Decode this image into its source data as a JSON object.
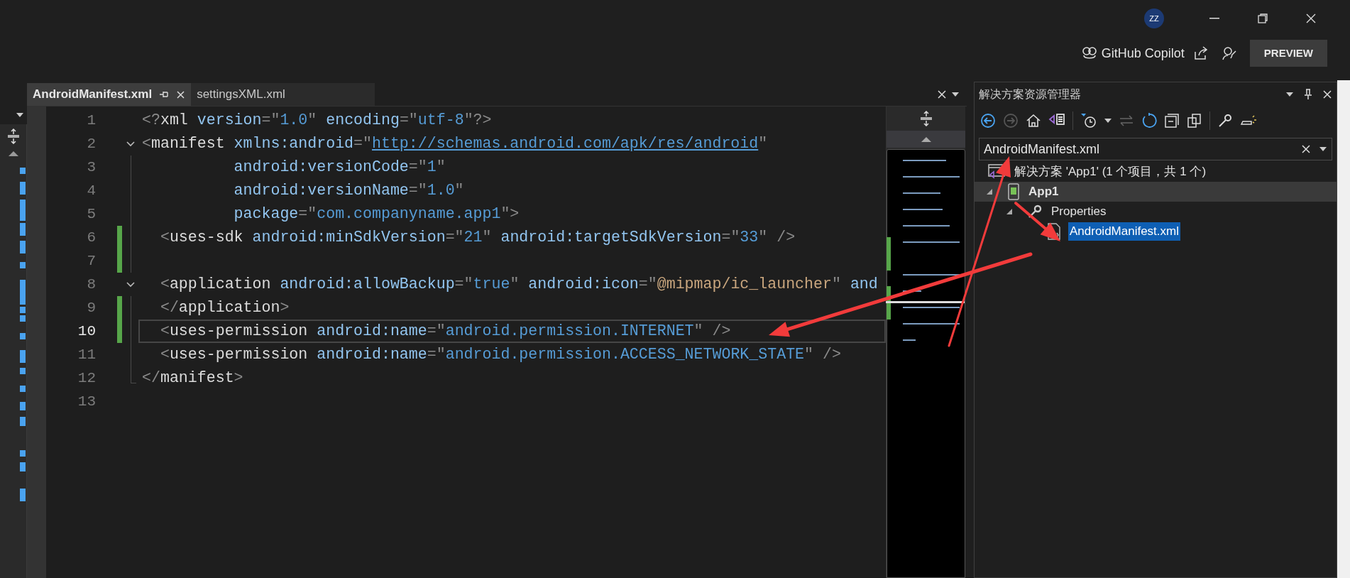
{
  "title_bar": {
    "avatar": "ZZ",
    "copilot": "GitHub Copilot",
    "preview_button": "PREVIEW"
  },
  "editor": {
    "tabs": [
      {
        "label": "AndroidManifest.xml",
        "selected": true
      },
      {
        "label": "settingsXML.xml",
        "selected": false
      }
    ],
    "lines": [
      {
        "number": "1",
        "changed": false,
        "current": false,
        "kind": "plain",
        "tokens": [
          {
            "kind": "punct",
            "text": "<?"
          },
          {
            "kind": "tag",
            "text": "xml"
          },
          {
            "kind": "attr",
            "text": " version"
          },
          {
            "kind": "punct",
            "text": "=\""
          },
          {
            "kind": "value",
            "text": "1.0"
          },
          {
            "kind": "punct",
            "text": "\""
          },
          {
            "kind": "attr",
            "text": " encoding"
          },
          {
            "kind": "punct",
            "text": "=\""
          },
          {
            "kind": "value",
            "text": "utf-8"
          },
          {
            "kind": "punct",
            "text": "\"?>"
          }
        ]
      },
      {
        "number": "2",
        "changed": false,
        "current": false,
        "kind": "start",
        "tokens": [
          {
            "kind": "punct",
            "text": "<"
          },
          {
            "kind": "tag",
            "text": "manifest"
          },
          {
            "kind": "attr",
            "text": " xmlns:android"
          },
          {
            "kind": "punct",
            "text": "=\""
          },
          {
            "kind": "link",
            "text": "http://schemas.android.com/apk/res/android"
          },
          {
            "kind": "punct",
            "text": "\""
          }
        ]
      },
      {
        "number": "3",
        "changed": false,
        "current": false,
        "kind": "inside",
        "tokens": [
          {
            "kind": "attr",
            "text": "          android:versionCode"
          },
          {
            "kind": "punct",
            "text": "=\""
          },
          {
            "kind": "value",
            "text": "1"
          },
          {
            "kind": "punct",
            "text": "\""
          }
        ]
      },
      {
        "number": "4",
        "changed": false,
        "current": false,
        "kind": "inside",
        "tokens": [
          {
            "kind": "attr",
            "text": "          android:versionName"
          },
          {
            "kind": "punct",
            "text": "=\""
          },
          {
            "kind": "value",
            "text": "1.0"
          },
          {
            "kind": "punct",
            "text": "\""
          }
        ]
      },
      {
        "number": "5",
        "changed": false,
        "current": false,
        "kind": "inside",
        "tokens": [
          {
            "kind": "attr",
            "text": "          package"
          },
          {
            "kind": "punct",
            "text": "=\""
          },
          {
            "kind": "value",
            "text": "com.companyname.app1"
          },
          {
            "kind": "punct",
            "text": "\">"
          }
        ]
      },
      {
        "number": "6",
        "changed": true,
        "current": false,
        "kind": "inside",
        "tokens": [
          {
            "kind": "punct",
            "text": "  <"
          },
          {
            "kind": "tag",
            "text": "uses-sdk"
          },
          {
            "kind": "attr",
            "text": " android:minSdkVersion"
          },
          {
            "kind": "punct",
            "text": "=\""
          },
          {
            "kind": "value",
            "text": "21"
          },
          {
            "kind": "punct",
            "text": "\""
          },
          {
            "kind": "attr",
            "text": " android:targetSdkVersion"
          },
          {
            "kind": "punct",
            "text": "=\""
          },
          {
            "kind": "value",
            "text": "33"
          },
          {
            "kind": "punct",
            "text": "\" />"
          }
        ]
      },
      {
        "number": "7",
        "changed": true,
        "current": false,
        "kind": "inside"
      },
      {
        "number": "8",
        "changed": false,
        "current": false,
        "kind": "start",
        "tokens": [
          {
            "kind": "punct",
            "text": "  <"
          },
          {
            "kind": "tag",
            "text": "application"
          },
          {
            "kind": "attr",
            "text": " android:allowBackup"
          },
          {
            "kind": "punct",
            "text": "=\""
          },
          {
            "kind": "value",
            "text": "true"
          },
          {
            "kind": "punct",
            "text": "\""
          },
          {
            "kind": "attr",
            "text": " android:icon"
          },
          {
            "kind": "punct",
            "text": "=\""
          },
          {
            "kind": "resource",
            "text": "@mipmap/ic_launcher"
          },
          {
            "kind": "punct",
            "text": "\""
          },
          {
            "kind": "attr",
            "text": " and"
          }
        ]
      },
      {
        "number": "9",
        "changed": true,
        "current": false,
        "kind": "inside",
        "tokens": [
          {
            "kind": "punct",
            "text": "  </"
          },
          {
            "kind": "tag",
            "text": "application"
          },
          {
            "kind": "punct",
            "text": ">"
          }
        ]
      },
      {
        "number": "10",
        "changed": true,
        "current": true,
        "kind": "inside",
        "tokens": [
          {
            "kind": "punct",
            "text": "  <"
          },
          {
            "kind": "tag",
            "text": "uses-permission"
          },
          {
            "kind": "attr",
            "text": " android:name"
          },
          {
            "kind": "punct",
            "text": "=\""
          },
          {
            "kind": "value",
            "text": "android.permission.INTERNET"
          },
          {
            "kind": "punct",
            "text": "\" />"
          }
        ]
      },
      {
        "number": "11",
        "changed": false,
        "current": false,
        "kind": "inside",
        "tokens": [
          {
            "kind": "punct",
            "text": "  <"
          },
          {
            "kind": "tag",
            "text": "uses-permission"
          },
          {
            "kind": "attr",
            "text": " android:name"
          },
          {
            "kind": "punct",
            "text": "=\""
          },
          {
            "kind": "value",
            "text": "android.permission.ACCESS_NETWORK_STATE"
          },
          {
            "kind": "punct",
            "text": "\" />"
          }
        ]
      },
      {
        "number": "12",
        "changed": false,
        "current": false,
        "kind": "end",
        "tokens": [
          {
            "kind": "punct",
            "text": "</"
          },
          {
            "kind": "tag",
            "text": "manifest"
          },
          {
            "kind": "punct",
            "text": ">"
          }
        ]
      },
      {
        "number": "13",
        "changed": false,
        "current": false,
        "kind": "plain"
      }
    ]
  },
  "solution_explorer": {
    "title": "解决方案资源管理器",
    "search": {
      "value": "AndroidManifest.xml"
    },
    "tree": [
      {
        "label": "解决方案 'App1' (1 个项目，共 1 个)",
        "kind": "solution",
        "selected": false,
        "hovered": false,
        "children": [
          {
            "label": "App1",
            "kind": "project",
            "selected": false,
            "hovered": true,
            "expanded": true,
            "children": [
              {
                "label": "Properties",
                "kind": "folder",
                "selected": false,
                "hovered": false,
                "expanded": true,
                "children": [
                  {
                    "label": "AndroidManifest.xml",
                    "kind": "file",
                    "selected": true,
                    "hovered": false
                  }
                ]
              }
            ]
          }
        ]
      }
    ]
  }
}
